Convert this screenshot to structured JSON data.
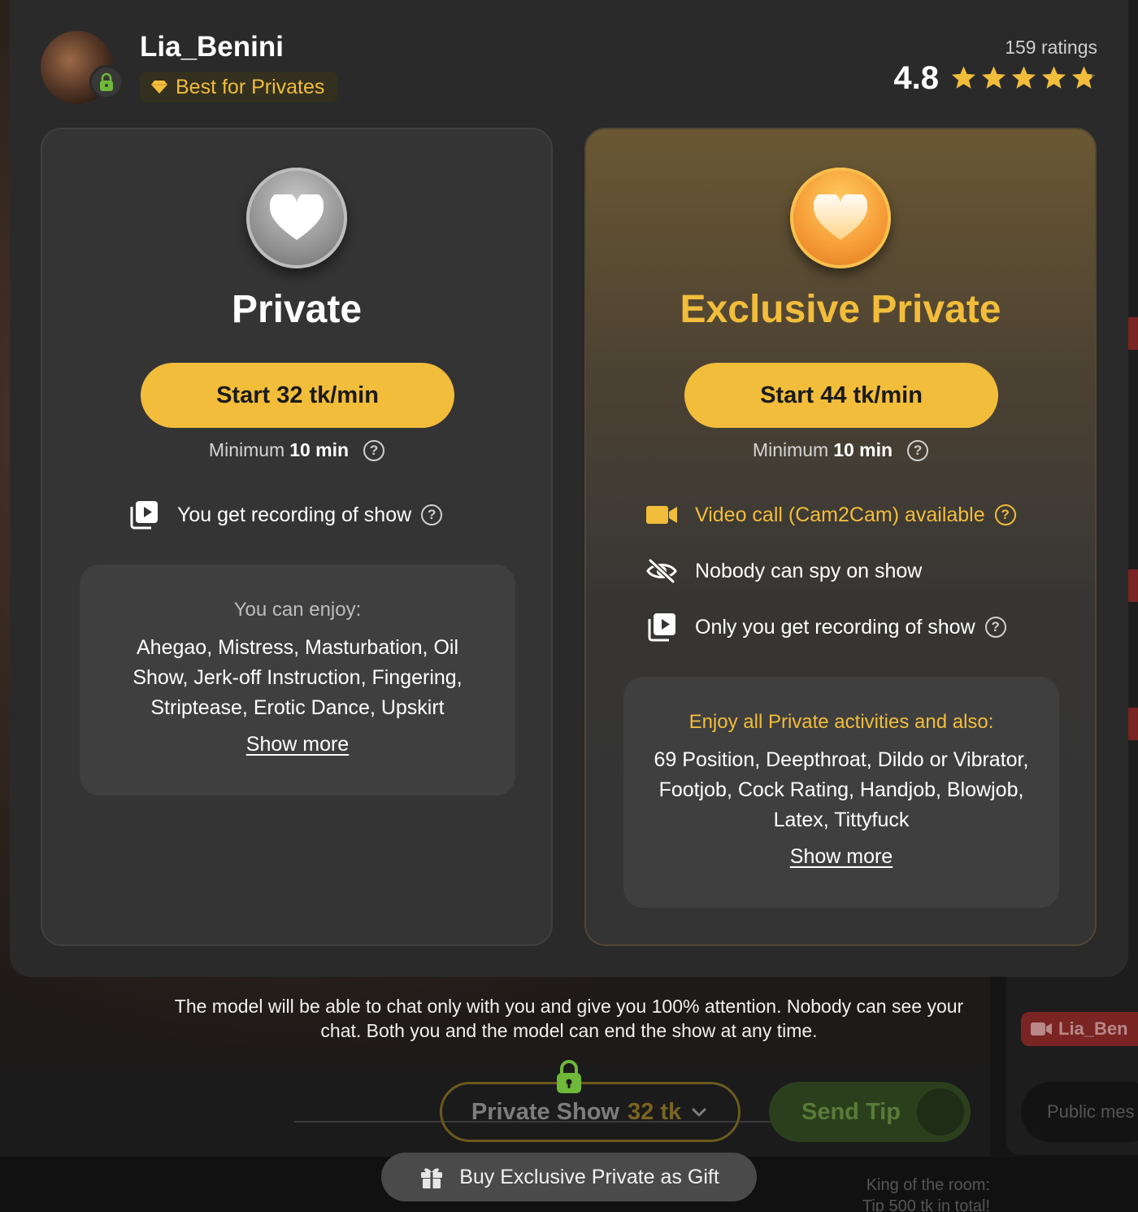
{
  "model": {
    "name": "Lia_Benini",
    "badge": "Best for Privates",
    "ratings_count": "159 ratings",
    "rating": "4.8",
    "rating_value": 4.8,
    "stars_max": 5
  },
  "private": {
    "title": "Private",
    "start_label": "Start 32 tk/min",
    "minimum_prefix": "Minimum",
    "minimum_value": "10 min",
    "features": [
      {
        "icon": "recording-icon",
        "label": "You get recording of show"
      }
    ],
    "enjoy_title": "You can enjoy:",
    "enjoy_list": "Ahegao, Mistress, Masturbation, Oil Show, Jerk-off Instruction, Fingering, Striptease, Erotic Dance, Upskirt",
    "show_more": "Show more"
  },
  "exclusive": {
    "title": "Exclusive Private",
    "start_label": "Start 44 tk/min",
    "minimum_prefix": "Minimum",
    "minimum_value": "10 min",
    "features": [
      {
        "icon": "video-camera-icon",
        "label": "Video call (Cam2Cam) available"
      },
      {
        "icon": "eye-off-icon",
        "label": "Nobody can spy on show"
      },
      {
        "icon": "recording-icon",
        "label": "Only you get recording of show"
      }
    ],
    "enjoy_title": "Enjoy all Private activities and also:",
    "enjoy_list": "69 Position, Deepthroat, Dildo or Vibrator, Footjob, Cock Rating, Handjob, Blowjob, Latex, Tittyfuck",
    "show_more": "Show more"
  },
  "footer": {
    "explanation": "The model will be able to chat only with you and give you 100% attention. Nobody can see your chat. Both you and the model can end the show at any time.",
    "private_show_label": "Private Show",
    "private_show_price": "32 tk",
    "send_tip_label": "Send Tip",
    "gift_label": "Buy Exclusive Private as Gift",
    "side_chip_label": "Lia_Ben",
    "side_input_placeholder": "Public mes",
    "king_line1": "King of the room:",
    "king_line2": "Tip 500 tk in total!"
  },
  "colors": {
    "accent": "#f2bd3b",
    "modal_bg": "#2a2a2a",
    "card_bg": "#343434"
  }
}
